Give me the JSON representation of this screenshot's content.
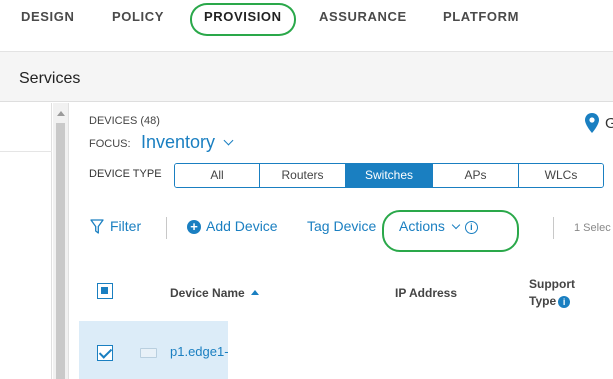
{
  "nav": {
    "items": [
      "DESIGN",
      "POLICY",
      "PROVISION",
      "ASSURANCE",
      "PLATFORM"
    ],
    "active": "PROVISION"
  },
  "page": {
    "title": "Services"
  },
  "devices": {
    "count_label": "DEVICES (48)",
    "focus_label": "FOCUS:",
    "focus_value": "Inventory",
    "location_text_partial": "G"
  },
  "device_type": {
    "label": "DEVICE TYPE",
    "options": [
      "All",
      "Routers",
      "Switches",
      "APs",
      "WLCs"
    ],
    "selected": "Switches"
  },
  "toolbar": {
    "filter": "Filter",
    "add_device": "Add Device",
    "tag_device": "Tag Device",
    "actions": "Actions",
    "selected_partial": "1 Selec"
  },
  "table": {
    "headers": {
      "device_name": "Device Name",
      "ip_address": "IP Address",
      "support_type_line1": "Support",
      "support_type_line2": "Type"
    },
    "rows": [
      {
        "device_name": "p1.edge1-",
        "checked": true
      }
    ]
  },
  "colors": {
    "accent": "#1a7fc1",
    "highlight_circle": "#2aa84a",
    "selected_row": "#dcecf8"
  },
  "icons": [
    "filter-icon",
    "plus-circle-icon",
    "info-icon",
    "location-pin-icon",
    "chevron-down-icon",
    "sort-asc-icon"
  ]
}
